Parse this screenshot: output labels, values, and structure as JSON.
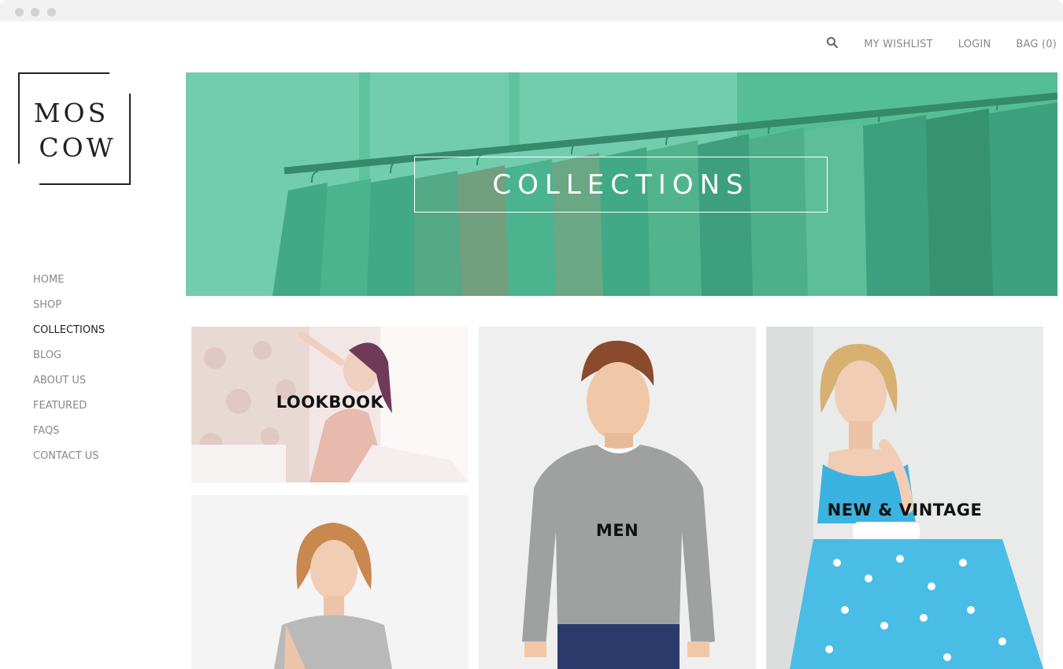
{
  "topnav": {
    "search_icon": "search-icon",
    "wishlist": "MY WISHLIST",
    "login": "LOGIN",
    "bag": "BAG (0)"
  },
  "logo": {
    "line1": "MOS",
    "line2": "COW"
  },
  "sidebar": {
    "items": [
      {
        "label": "HOME",
        "active": false
      },
      {
        "label": "SHOP",
        "active": false
      },
      {
        "label": "COLLECTIONS",
        "active": true
      },
      {
        "label": "BLOG",
        "active": false
      },
      {
        "label": "ABOUT US",
        "active": false
      },
      {
        "label": "FEATURED",
        "active": false
      },
      {
        "label": "FAQS",
        "active": false
      },
      {
        "label": "CONTACT US",
        "active": false
      }
    ]
  },
  "hero": {
    "title": "COLLECTIONS"
  },
  "tiles": {
    "lookbook": "LOOKBOOK",
    "men": "MEN",
    "vintage": "NEW & VINTAGE"
  },
  "colors": {
    "hero_overlay": "#46be96",
    "text_muted": "#888888",
    "text_active": "#222222"
  }
}
